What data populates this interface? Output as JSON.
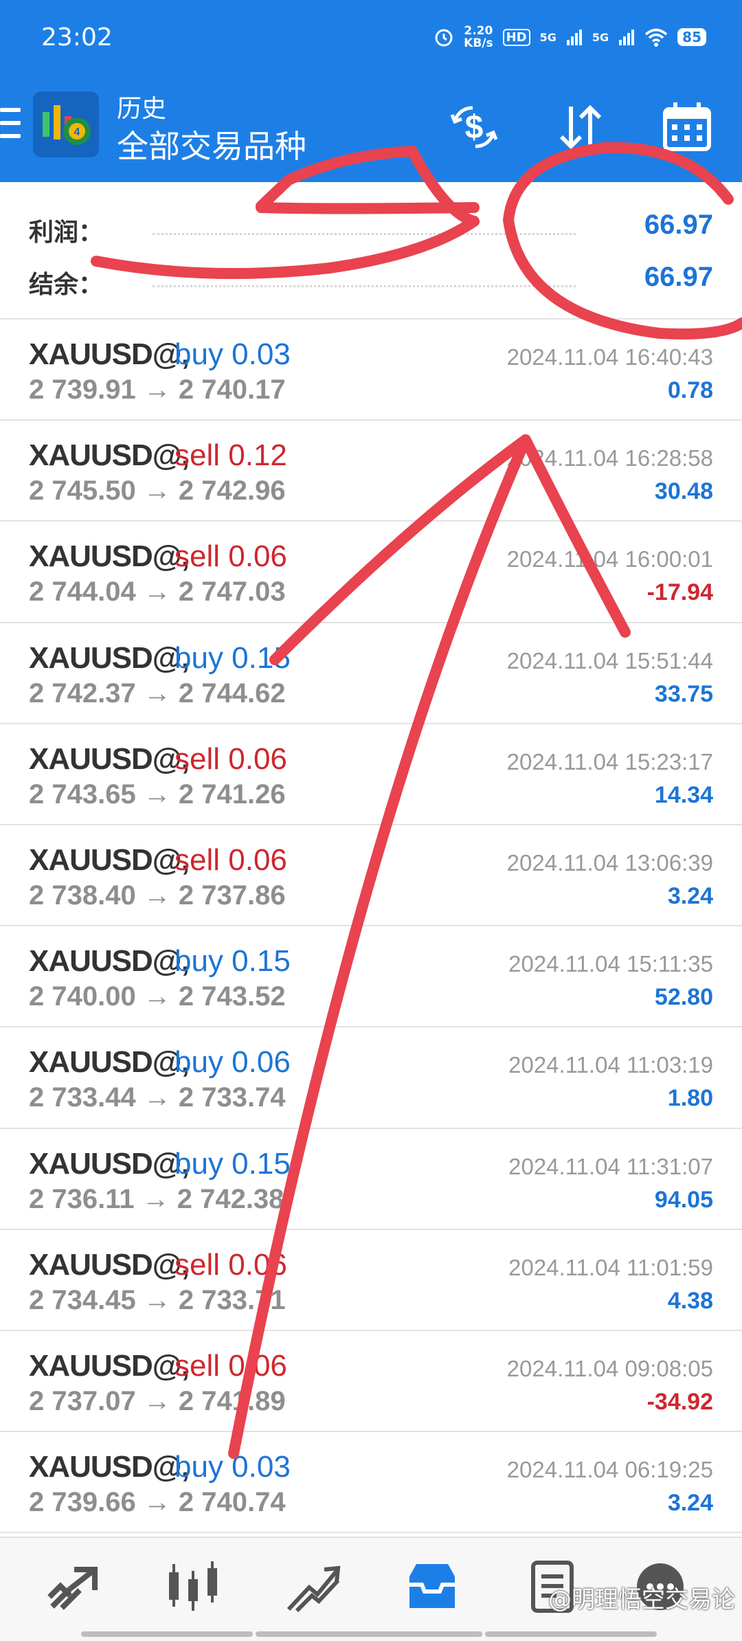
{
  "status_bar": {
    "time": "23:02",
    "speed_value": "2.20",
    "speed_unit": "KB/s",
    "hd_label": "HD",
    "net1": "5G",
    "net2": "5G",
    "battery": "85"
  },
  "app_bar": {
    "section_title": "历史",
    "filter_title": "全部交易品种",
    "icons": [
      "menu-icon",
      "app-logo",
      "currency-exchange-icon",
      "sort-icon",
      "calendar-icon"
    ]
  },
  "summary": {
    "profit_label": "利润：",
    "profit_value": "66.97",
    "balance_label": "结余：",
    "balance_value": "66.97"
  },
  "trades": [
    {
      "symbol": "XAUUSD@,",
      "side": "buy 0.03",
      "type": "buy",
      "prices": "2 739.91 → 2 740.17",
      "time": "2024.11.04 16:40:43",
      "profit": "0.78"
    },
    {
      "symbol": "XAUUSD@,",
      "side": "sell 0.12",
      "type": "sell",
      "prices": "2 745.50 → 2 742.96",
      "time": "2024.11.04 16:28:58",
      "profit": "30.48"
    },
    {
      "symbol": "XAUUSD@,",
      "side": "sell 0.06",
      "type": "sell",
      "prices": "2 744.04 → 2 747.03",
      "time": "2024.11.04 16:00:01",
      "profit": "-17.94"
    },
    {
      "symbol": "XAUUSD@,",
      "side": "buy 0.15",
      "type": "buy",
      "prices": "2 742.37 → 2 744.62",
      "time": "2024.11.04 15:51:44",
      "profit": "33.75"
    },
    {
      "symbol": "XAUUSD@,",
      "side": "sell 0.06",
      "type": "sell",
      "prices": "2 743.65 → 2 741.26",
      "time": "2024.11.04 15:23:17",
      "profit": "14.34"
    },
    {
      "symbol": "XAUUSD@,",
      "side": "sell 0.06",
      "type": "sell",
      "prices": "2 738.40 → 2 737.86",
      "time": "2024.11.04 13:06:39",
      "profit": "3.24"
    },
    {
      "symbol": "XAUUSD@,",
      "side": "buy 0.15",
      "type": "buy",
      "prices": "2 740.00 → 2 743.52",
      "time": "2024.11.04 15:11:35",
      "profit": "52.80"
    },
    {
      "symbol": "XAUUSD@,",
      "side": "buy 0.06",
      "type": "buy",
      "prices": "2 733.44 → 2 733.74",
      "time": "2024.11.04 11:03:19",
      "profit": "1.80"
    },
    {
      "symbol": "XAUUSD@,",
      "side": "buy 0.15",
      "type": "buy",
      "prices": "2 736.11 → 2 742.38",
      "time": "2024.11.04 11:31:07",
      "profit": "94.05"
    },
    {
      "symbol": "XAUUSD@,",
      "side": "sell 0.06",
      "type": "sell",
      "prices": "2 734.45 → 2 733.71",
      "time": "2024.11.04 11:01:59",
      "profit": "4.38"
    },
    {
      "symbol": "XAUUSD@,",
      "side": "sell 0.06",
      "type": "sell",
      "prices": "2 737.07 → 2 741.89",
      "time": "2024.11.04 09:08:05",
      "profit": "-34.92"
    },
    {
      "symbol": "XAUUSD@,",
      "side": "buy 0.03",
      "type": "buy",
      "prices": "2 739.66 → 2 740.74",
      "time": "2024.11.04 06:19:25",
      "profit": "3.24"
    }
  ],
  "bottom_nav": {
    "items": [
      "quotes-icon",
      "chart-icon",
      "trade-icon",
      "history-icon",
      "news-icon",
      "messages-icon"
    ],
    "active": "history-icon"
  },
  "watermark": "@明理悟空交易论",
  "colors": {
    "header": "#1d7fe6",
    "positive": "#1d74d6",
    "negative": "#d0262e",
    "annotation": "#e8434f"
  }
}
